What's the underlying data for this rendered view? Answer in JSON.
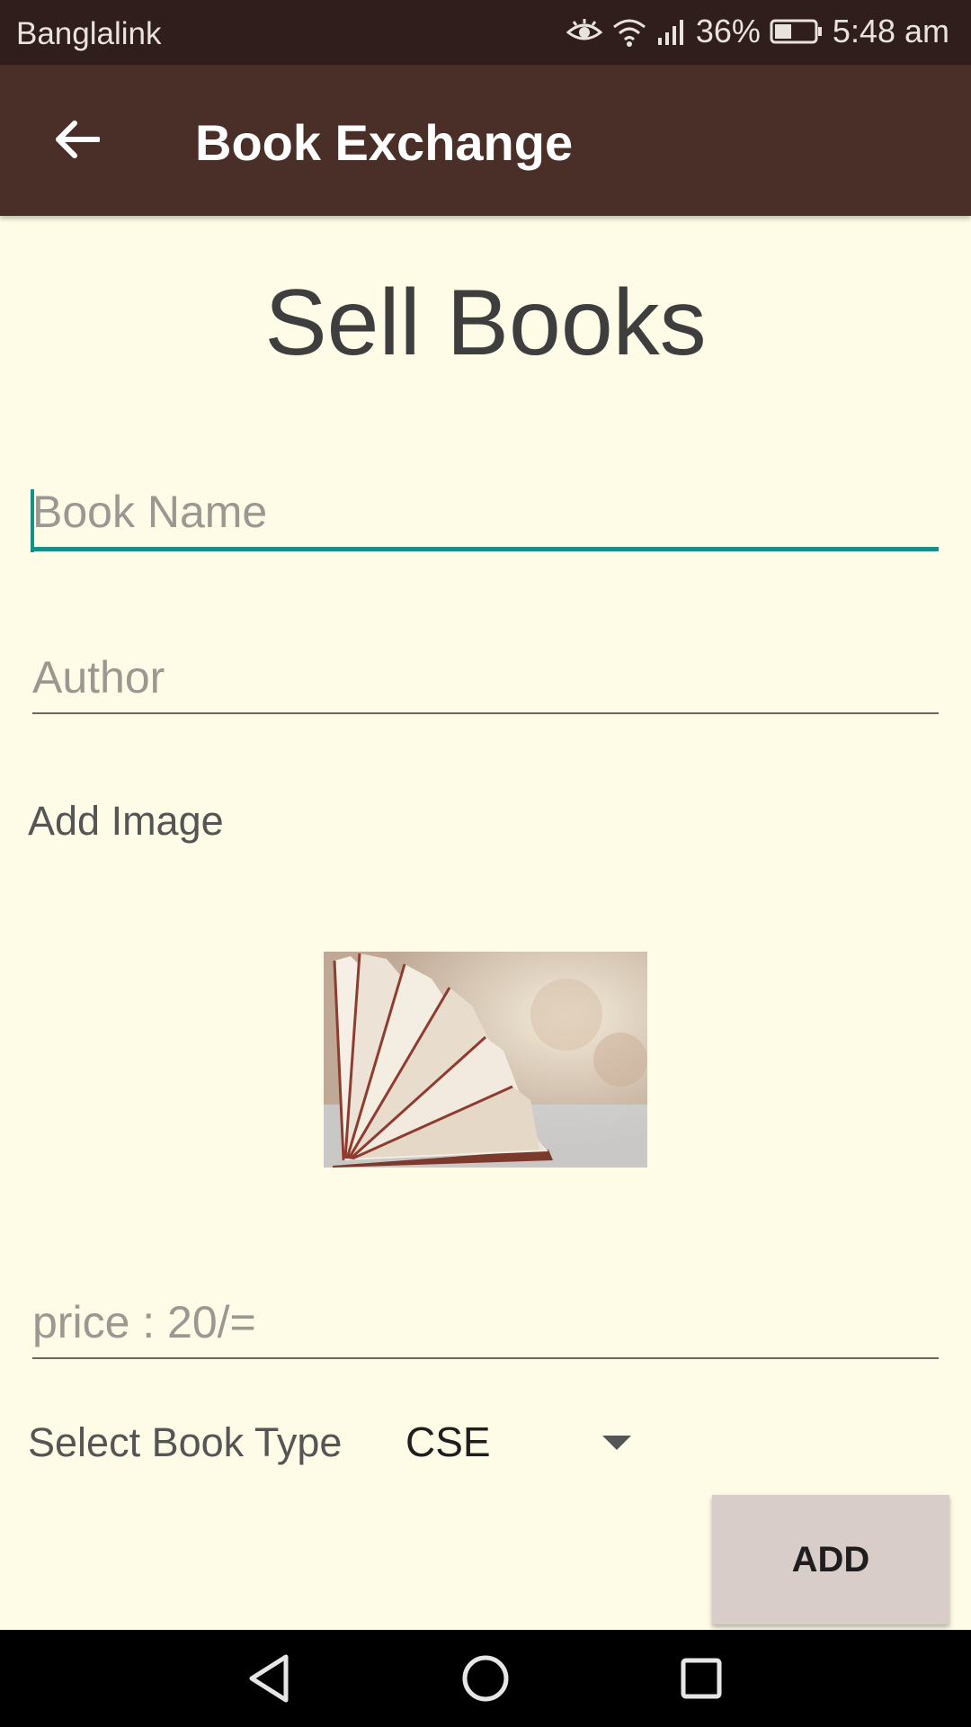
{
  "status_bar": {
    "carrier": "Banglalink",
    "battery": "36%",
    "time": "5:48 am",
    "icons": [
      "eye-icon",
      "wifi-icon",
      "signal-icon",
      "battery-icon"
    ]
  },
  "app_bar": {
    "title": "Book Exchange",
    "back_icon": "arrow-left-icon",
    "color": "#4a2f29"
  },
  "form": {
    "heading": "Sell Books",
    "book_name": {
      "value": "",
      "placeholder": "Book Name"
    },
    "author": {
      "value": "",
      "placeholder": "Author"
    },
    "add_image_label": "Add Image",
    "price": {
      "value": "",
      "placeholder": "price : 20/="
    },
    "book_type_label": "Select Book Type",
    "book_type_selected": "CSE",
    "add_button": "ADD"
  },
  "colors": {
    "background": "#fefbe6",
    "accent": "#158f87",
    "status_bar": "#2f1e1b"
  },
  "nav_bar": {
    "icons": [
      "back-triangle-icon",
      "home-circle-icon",
      "recents-square-icon"
    ]
  }
}
